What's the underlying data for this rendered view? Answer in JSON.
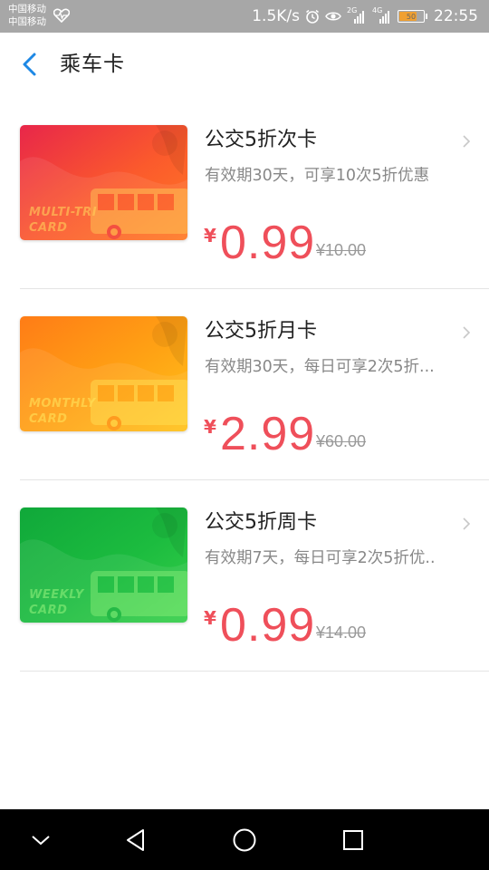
{
  "status_bar": {
    "carrier_1": "中国移动",
    "carrier_2": "中国移动",
    "net_speed": "1.5K/s",
    "signal_1": "2G",
    "signal_2": "4G",
    "battery": "50",
    "time": "22:55"
  },
  "header": {
    "title": "乘车卡"
  },
  "cards": [
    {
      "name": "公交5折次卡",
      "description": "有效期30天，可享10次5折优惠",
      "currency": "¥",
      "price": "0.99",
      "original_price": "¥10.00",
      "thumb_label": "MULTI-TRI\nCARD",
      "gradient": [
        "#e8264a",
        "#fb5a2c",
        "#ff7a24"
      ],
      "label_color": "#ffd05a"
    },
    {
      "name": "公交5折月卡",
      "description": "有效期30天，每日可享2次5折...",
      "currency": "¥",
      "price": "2.99",
      "original_price": "¥60.00",
      "thumb_label": "MONTHLY\nCARD",
      "gradient": [
        "#ff7c16",
        "#ffa214",
        "#ffc21a"
      ],
      "label_color": "#ffe45a"
    },
    {
      "name": "公交5折周卡",
      "description": "有效期7天，每日可享2次5折优..",
      "currency": "¥",
      "price": "0.99",
      "original_price": "¥14.00",
      "thumb_label": "WEEKLY\nCARD",
      "gradient": [
        "#10a83a",
        "#1cbc3f",
        "#36cf4a"
      ],
      "label_color": "#8ff07a"
    }
  ],
  "colors": {
    "accent": "#1e88e5",
    "price": "#ef4f5a",
    "status_bar": "#a7a7a7",
    "nav_bar": "#000000"
  },
  "nav": {
    "buttons": [
      "chevron-down-icon",
      "back-triangle-icon",
      "home-circle-icon",
      "recent-square-icon"
    ]
  }
}
